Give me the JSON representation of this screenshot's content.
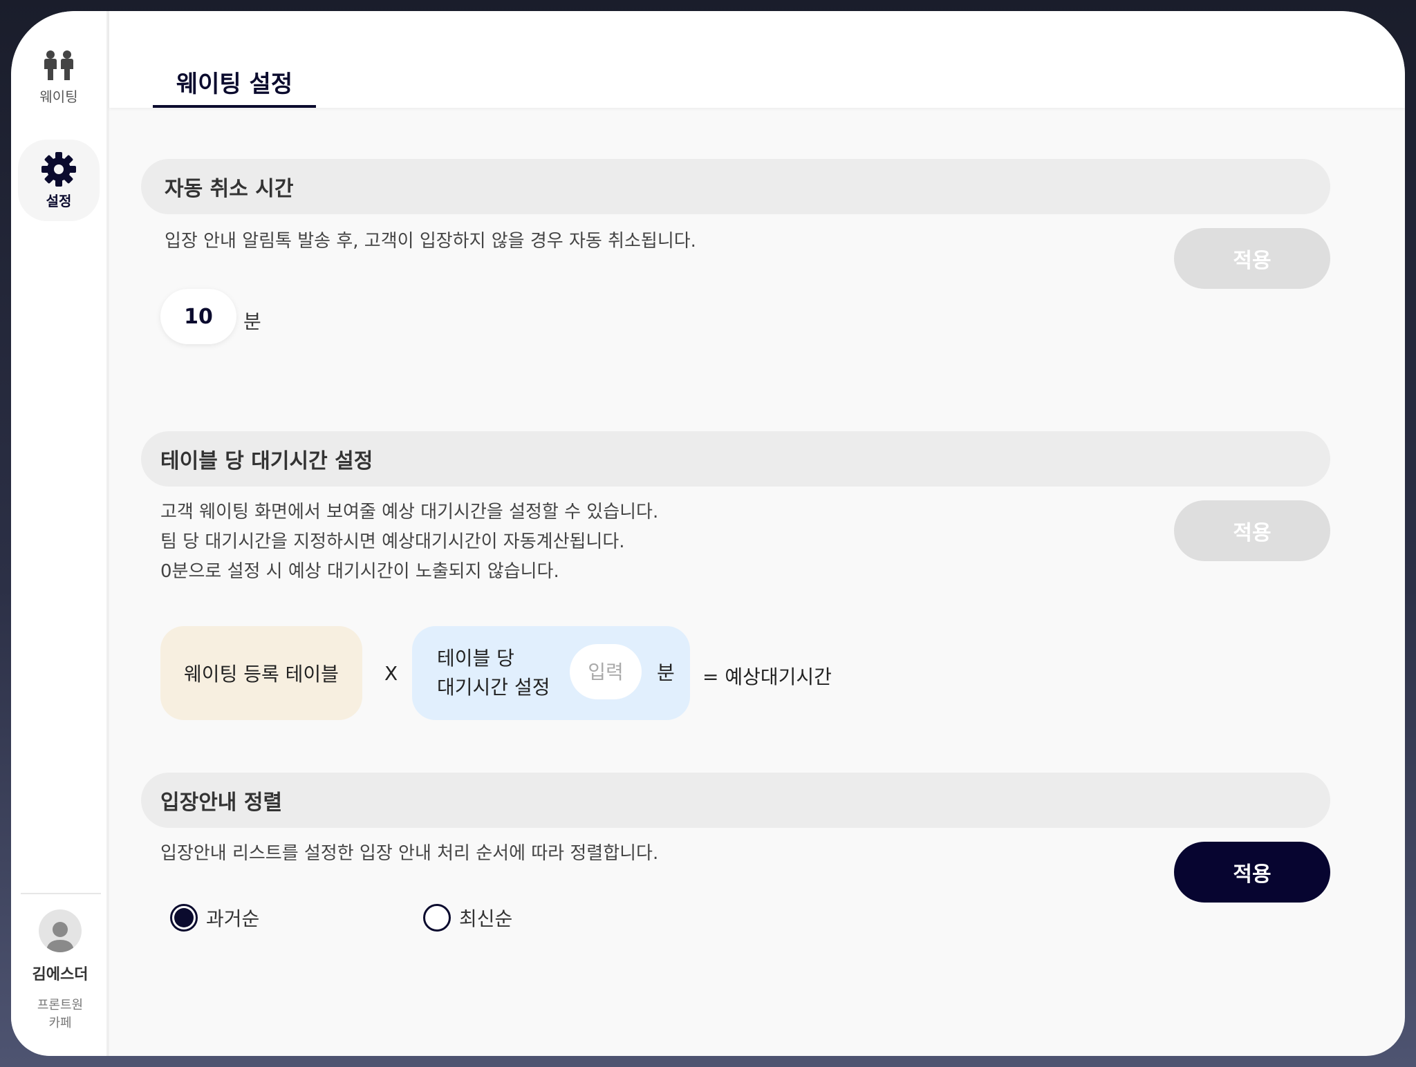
{
  "sidebar": {
    "nav_waiting": {
      "label": "웨이팅",
      "icon": "people-icon"
    },
    "nav_settings": {
      "label": "설정",
      "icon": "gear-icon"
    },
    "profile": {
      "name": "김에스더",
      "store": "프론트원 카페"
    }
  },
  "header": {
    "active_tab": "웨이팅 설정"
  },
  "auto_cancel": {
    "title": "자동 취소 시간",
    "description": "입장 안내 알림톡 발송 후, 고객이 입장하지 않을 경우 자동 취소됩니다.",
    "value": "10",
    "unit": "분",
    "apply_label": "적용",
    "apply_enabled": false
  },
  "wait_time": {
    "title": "테이블 당 대기시간 설정",
    "description_lines": [
      "고객 웨이팅 화면에서 보여줄 예상 대기시간을 설정할 수 있습니다.",
      "팀 당 대기시간을 지정하시면 예상대기시간이 자동계산됩니다.",
      "0분으로 설정 시 예상 대기시간이 노출되지 않습니다."
    ],
    "apply_label": "적용",
    "apply_enabled": false,
    "formula": {
      "operand_a": "웨이팅 등록 테이블",
      "operator": "X",
      "operand_b_line1": "테이블 당",
      "operand_b_line2": "대기시간 설정",
      "input_placeholder": "입력",
      "unit": "분",
      "result": "= 예상대기시간"
    }
  },
  "entry_sort": {
    "title": "입장안내 정렬",
    "description": "입장안내 리스트를 설정한 입장 안내 처리 순서에 따라 정렬합니다.",
    "apply_label": "적용",
    "apply_enabled": true,
    "options": [
      {
        "label": "과거순",
        "selected": true
      },
      {
        "label": "최신순",
        "selected": false
      }
    ]
  },
  "colors": {
    "primary": "#070530",
    "disabled_button": "#dedede",
    "orange_pill": "#f7efe0",
    "blue_pill": "#e1effd"
  }
}
